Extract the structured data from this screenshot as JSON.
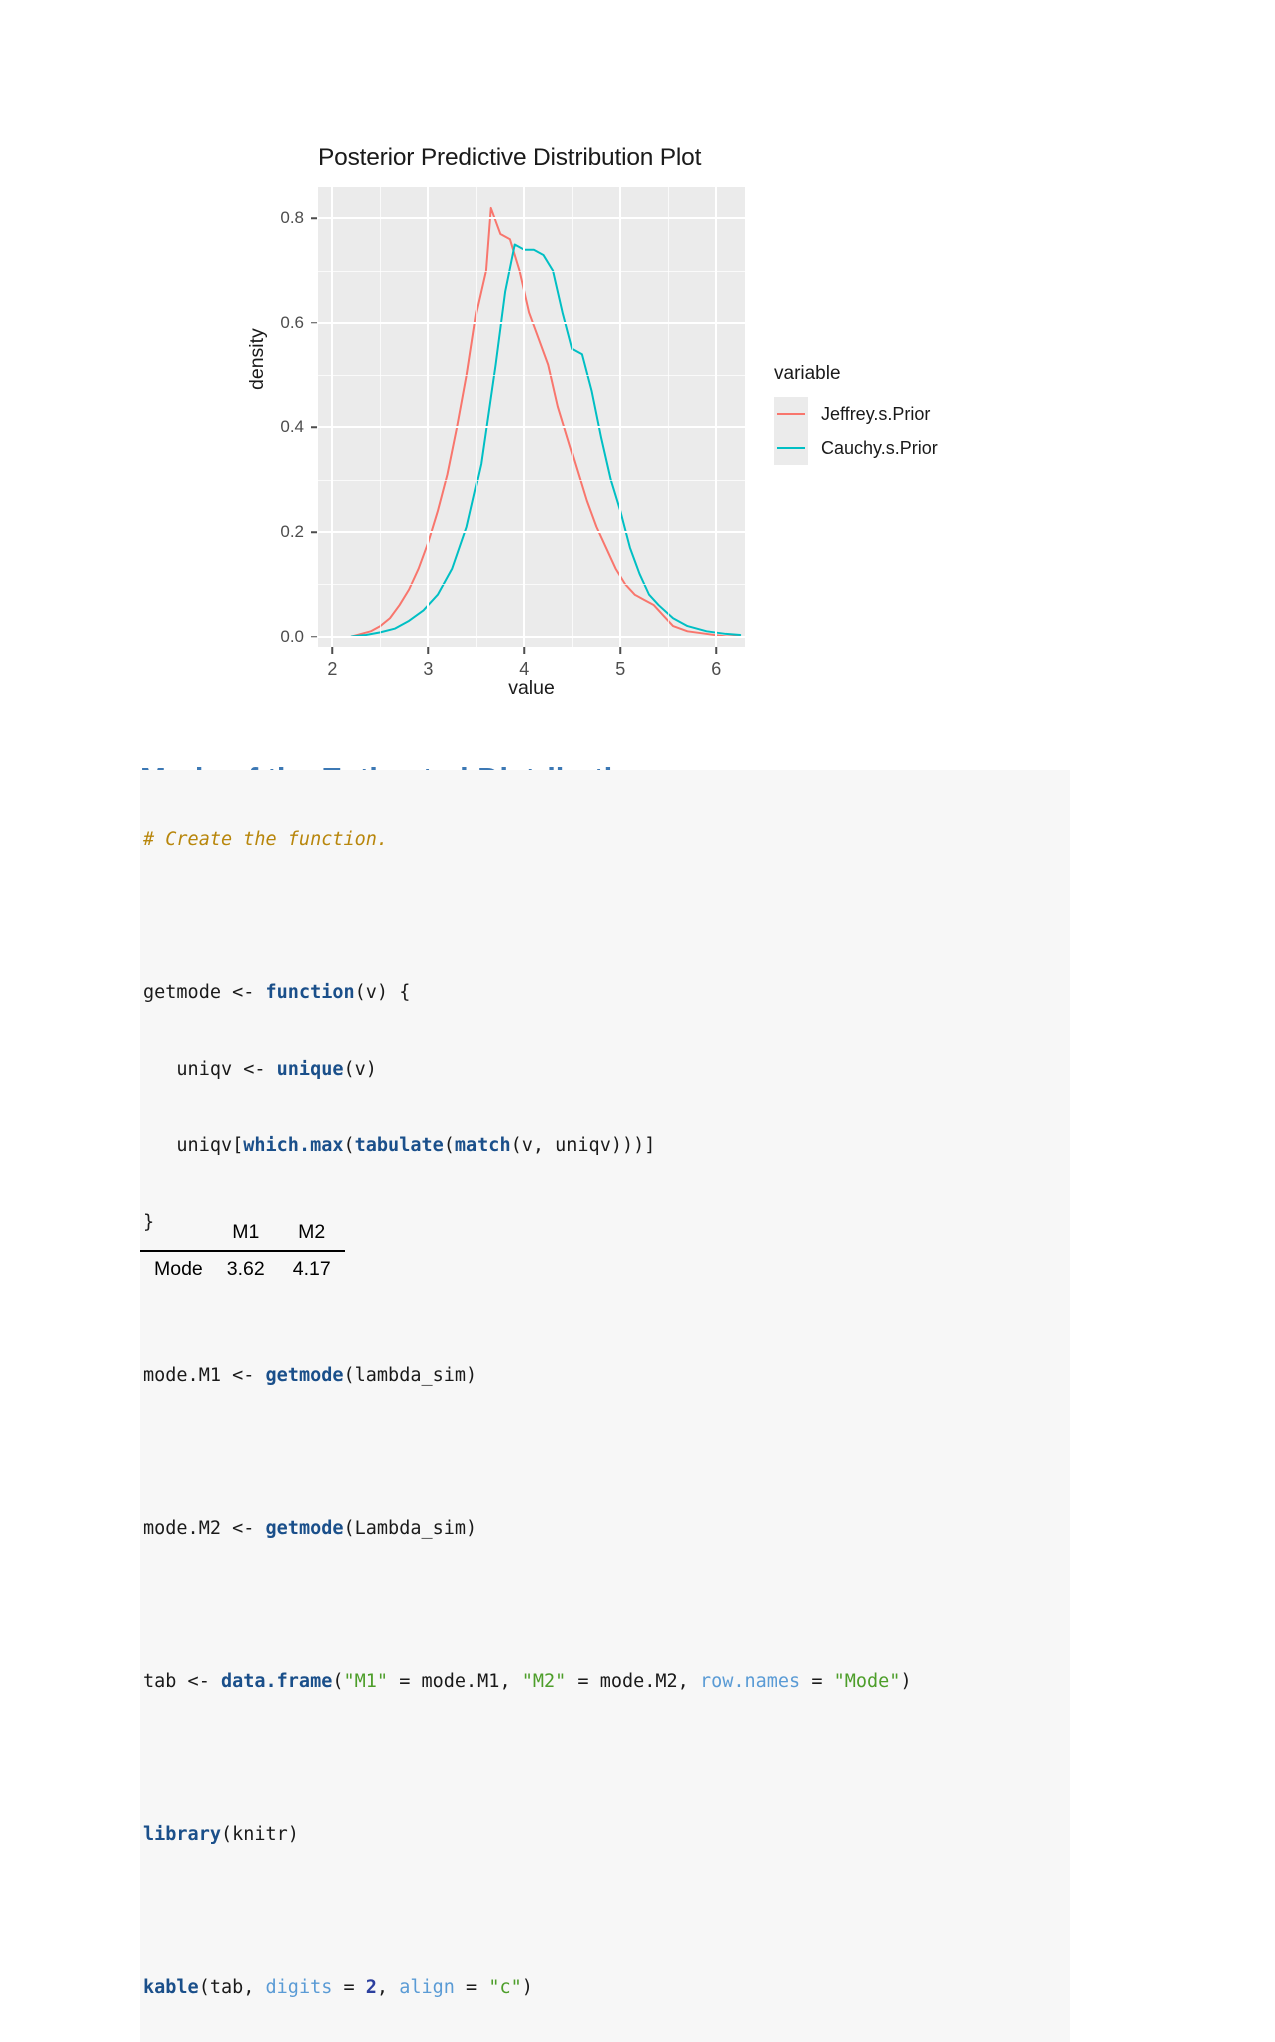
{
  "chart_data": {
    "type": "line",
    "title": "Posterior Predictive Distribution Plot",
    "xlabel": "value",
    "ylabel": "density",
    "xlim": [
      1.85,
      6.3
    ],
    "ylim": [
      -0.02,
      0.86
    ],
    "xticks": [
      "2",
      "3",
      "4",
      "5",
      "6"
    ],
    "xtick_values": [
      2,
      3,
      4,
      5,
      6
    ],
    "yticks": [
      "0.0",
      "0.2",
      "0.4",
      "0.6",
      "0.8"
    ],
    "ytick_values": [
      0.0,
      0.2,
      0.4,
      0.6,
      0.8
    ],
    "grid": true,
    "legend_position": "right",
    "legend_title": "variable",
    "series": [
      {
        "name": "Jeffrey.s.Prior",
        "color": "#f8766d",
        "x": [
          2.2,
          2.3,
          2.4,
          2.5,
          2.6,
          2.7,
          2.8,
          2.9,
          3.0,
          3.1,
          3.2,
          3.3,
          3.4,
          3.5,
          3.6,
          3.65,
          3.75,
          3.85,
          3.95,
          4.05,
          4.15,
          4.25,
          4.35,
          4.45,
          4.55,
          4.65,
          4.75,
          4.85,
          4.95,
          5.05,
          5.15,
          5.25,
          5.35,
          5.45,
          5.55,
          5.7,
          5.9,
          6.1,
          6.25
        ],
        "y": [
          0.0,
          0.005,
          0.01,
          0.02,
          0.035,
          0.06,
          0.09,
          0.13,
          0.18,
          0.24,
          0.31,
          0.4,
          0.5,
          0.62,
          0.7,
          0.82,
          0.77,
          0.76,
          0.7,
          0.62,
          0.57,
          0.52,
          0.44,
          0.38,
          0.32,
          0.26,
          0.21,
          0.17,
          0.13,
          0.1,
          0.08,
          0.07,
          0.06,
          0.04,
          0.02,
          0.01,
          0.005,
          0.0,
          0.0
        ]
      },
      {
        "name": "Cauchy.s.Prior",
        "color": "#00bfc4",
        "x": [
          2.2,
          2.35,
          2.5,
          2.65,
          2.8,
          2.95,
          3.1,
          3.25,
          3.4,
          3.55,
          3.7,
          3.8,
          3.9,
          4.0,
          4.1,
          4.2,
          4.3,
          4.4,
          4.5,
          4.6,
          4.7,
          4.8,
          4.9,
          5.0,
          5.1,
          5.2,
          5.3,
          5.4,
          5.55,
          5.7,
          5.9,
          6.1,
          6.25
        ],
        "y": [
          0.0,
          0.003,
          0.008,
          0.015,
          0.03,
          0.05,
          0.08,
          0.13,
          0.21,
          0.33,
          0.52,
          0.66,
          0.75,
          0.74,
          0.74,
          0.73,
          0.7,
          0.62,
          0.55,
          0.54,
          0.47,
          0.38,
          0.3,
          0.24,
          0.17,
          0.12,
          0.08,
          0.06,
          0.035,
          0.02,
          0.01,
          0.005,
          0.003
        ]
      }
    ]
  },
  "section": {
    "heading": "Mode of the Estimated Distributions"
  },
  "code": {
    "comment": "# Create the function.",
    "l1_p1": "getmode <- ",
    "l1_fn": "function",
    "l1_p2": "(v) {",
    "l2_p1": "   uniqv <- ",
    "l2_fn": "unique",
    "l2_p2": "(v)",
    "l3_p1": "   uniqv[",
    "l3_fn1": "which.max",
    "l3_p2": "(",
    "l3_fn2": "tabulate",
    "l3_p3": "(",
    "l3_fn3": "match",
    "l3_p4": "(v, uniqv)))]",
    "l4": "}",
    "l5_p1": "mode.M1 <- ",
    "l5_fn": "getmode",
    "l5_p2": "(lambda_sim)",
    "l6_p1": "mode.M2 <- ",
    "l6_fn": "getmode",
    "l6_p2": "(Lambda_sim)",
    "l7_p1": "tab <- ",
    "l7_fn": "data.frame",
    "l7_p2": "(",
    "l7_s1": "\"M1\"",
    "l7_p3": " = mode.M1, ",
    "l7_s2": "\"M2\"",
    "l7_p4": " = mode.M2, ",
    "l7_arg": "row.names",
    "l7_p5": " = ",
    "l7_s3": "\"Mode\"",
    "l7_p6": ")",
    "l8_fn": "library",
    "l8_p1": "(knitr)",
    "l9_fn": "kable",
    "l9_p1": "(tab, ",
    "l9_arg1": "digits",
    "l9_p2": " = ",
    "l9_num": "2",
    "l9_p3": ", ",
    "l9_arg2": "align",
    "l9_p4": " = ",
    "l9_s1": "\"c\"",
    "l9_p5": ")"
  },
  "table": {
    "columns": [
      "",
      "M1",
      "M2"
    ],
    "rows": [
      {
        "name": "Mode",
        "M1": "3.62",
        "M2": "4.17"
      }
    ]
  },
  "colors": {
    "heading": "#3c78b4",
    "jeffreys": "#f8766d",
    "cauchy": "#00bfc4",
    "panel": "#ebebeb",
    "code_bg": "#f7f7f7"
  }
}
